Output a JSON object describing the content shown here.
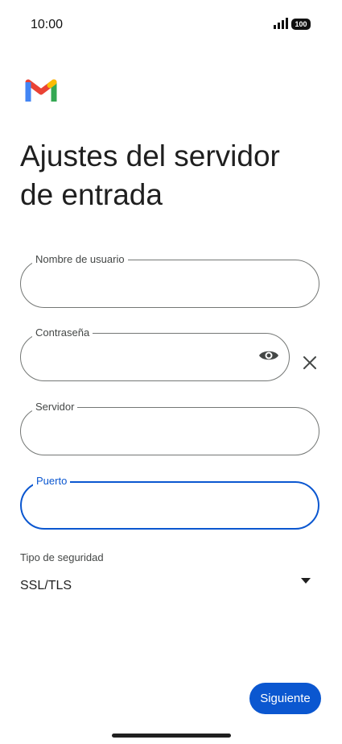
{
  "status_bar": {
    "time": "10:00",
    "battery": "100"
  },
  "app": {
    "logo_icon": "gmail-logo-icon"
  },
  "page": {
    "title_line1": "Ajustes del servidor",
    "title_line2": "de entrada"
  },
  "form": {
    "username": {
      "label": "Nombre de usuario",
      "value": ""
    },
    "password": {
      "label": "Contraseña",
      "value": "",
      "toggle_icon": "eye-icon",
      "clear_icon": "close-icon"
    },
    "server": {
      "label": "Servidor",
      "value": ""
    },
    "port": {
      "label": "Puerto",
      "value": "",
      "focused": true
    },
    "security": {
      "label": "Tipo de seguridad",
      "value": "SSL/TLS",
      "dropdown_icon": "dropdown-arrow-icon"
    }
  },
  "actions": {
    "next_label": "Siguiente"
  },
  "colors": {
    "accent": "#0b57d0",
    "outline": "#747775"
  }
}
